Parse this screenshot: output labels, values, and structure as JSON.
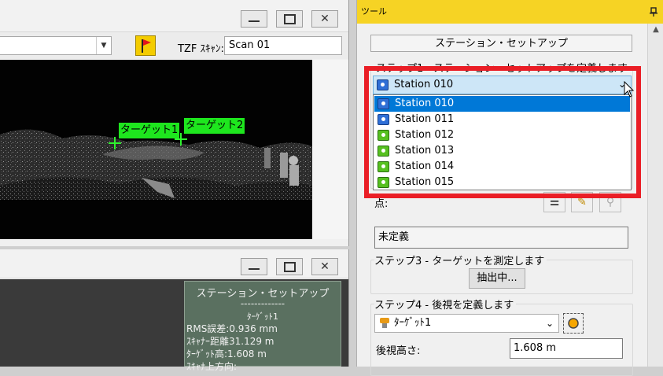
{
  "top_window": {
    "buttons": {
      "minimize": "▭",
      "maximize": "▢",
      "close": "✕"
    },
    "toolbar": {
      "tzf_label": "TZF ｽｷｬﾝ:",
      "scan_value": "Scan 01"
    },
    "viewport": {
      "targets": [
        {
          "label": "ターゲット1"
        },
        {
          "label": "ターゲット2"
        }
      ]
    }
  },
  "bottom_window": {
    "info": {
      "title": "ステーション・セットアップ",
      "separator": "-------------",
      "target_name": "ﾀｰｹﾞｯﾄ1",
      "rms": "RMS誤差:0.936 mm",
      "scanner_distance": "ｽｷｬﾅｰ距離31.129 m",
      "target_height": "ﾀｰｹﾞｯﾄ高:1.608 m",
      "scanner_up": "ｽｷｬﾅ上方向:"
    }
  },
  "tool_pane": {
    "title": "ツール",
    "pin": "ꟷ",
    "header": "ステーション・セットアップ",
    "step1_label": "ステップ1 - ステーション・セットアップを定義します",
    "station_dropdown": {
      "selected": "Station 010",
      "options": [
        {
          "label": "Station 010",
          "icon": "station-blue-icon"
        },
        {
          "label": "Station 011",
          "icon": "station-blue-icon"
        },
        {
          "label": "Station 012",
          "icon": "station-green-icon"
        },
        {
          "label": "Station 013",
          "icon": "station-green-icon"
        },
        {
          "label": "Station 014",
          "icon": "station-green-icon"
        },
        {
          "label": "Station 015",
          "icon": "station-green-icon"
        }
      ]
    },
    "point_label": "点:",
    "point_value": "未定義",
    "step3_label": "ステップ3 - ターゲットを測定します",
    "extract_button": "抽出中...",
    "step4_label": "ステップ4 - 後視を定義します",
    "backsight_target": "ﾀｰｹﾞｯﾄ1",
    "backsight_height_label": "後視高さ:",
    "backsight_height_value": "1.608 m"
  },
  "colors": {
    "accent_red": "#ea1e26",
    "pane_title": "#f6d324",
    "target_green": "#1ee61e",
    "selection_blue": "#0078d7"
  }
}
